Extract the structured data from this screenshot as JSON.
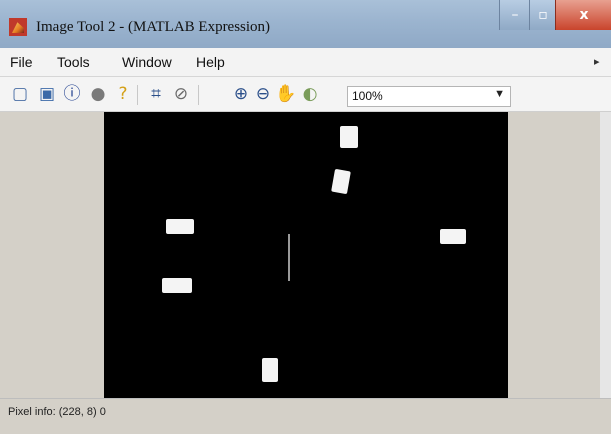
{
  "window": {
    "title": "Image Tool 2 - (MATLAB Expression)",
    "controls": {
      "minimize": "–",
      "maximize": "▫",
      "close": "x"
    }
  },
  "menu": {
    "items": [
      "File",
      "Tools",
      "Window",
      "Help"
    ]
  },
  "toolbar": {
    "icons": [
      "new-figure-icon",
      "open-icon",
      "info-icon",
      "overview-icon",
      "pixel-info-icon",
      "crop-icon",
      "measure-distance-icon",
      "zoom-in-icon",
      "zoom-out-icon",
      "pan-icon",
      "adjust-contrast-icon"
    ],
    "zoom": {
      "value": "100%"
    }
  },
  "status": {
    "pixel_info": "Pixel info: (228, 8) 0"
  },
  "colors": {
    "titlebar": "#9bb4cf",
    "image_background": "#000000",
    "blob": "#f4f4f4",
    "close_button": "#c9442c"
  }
}
